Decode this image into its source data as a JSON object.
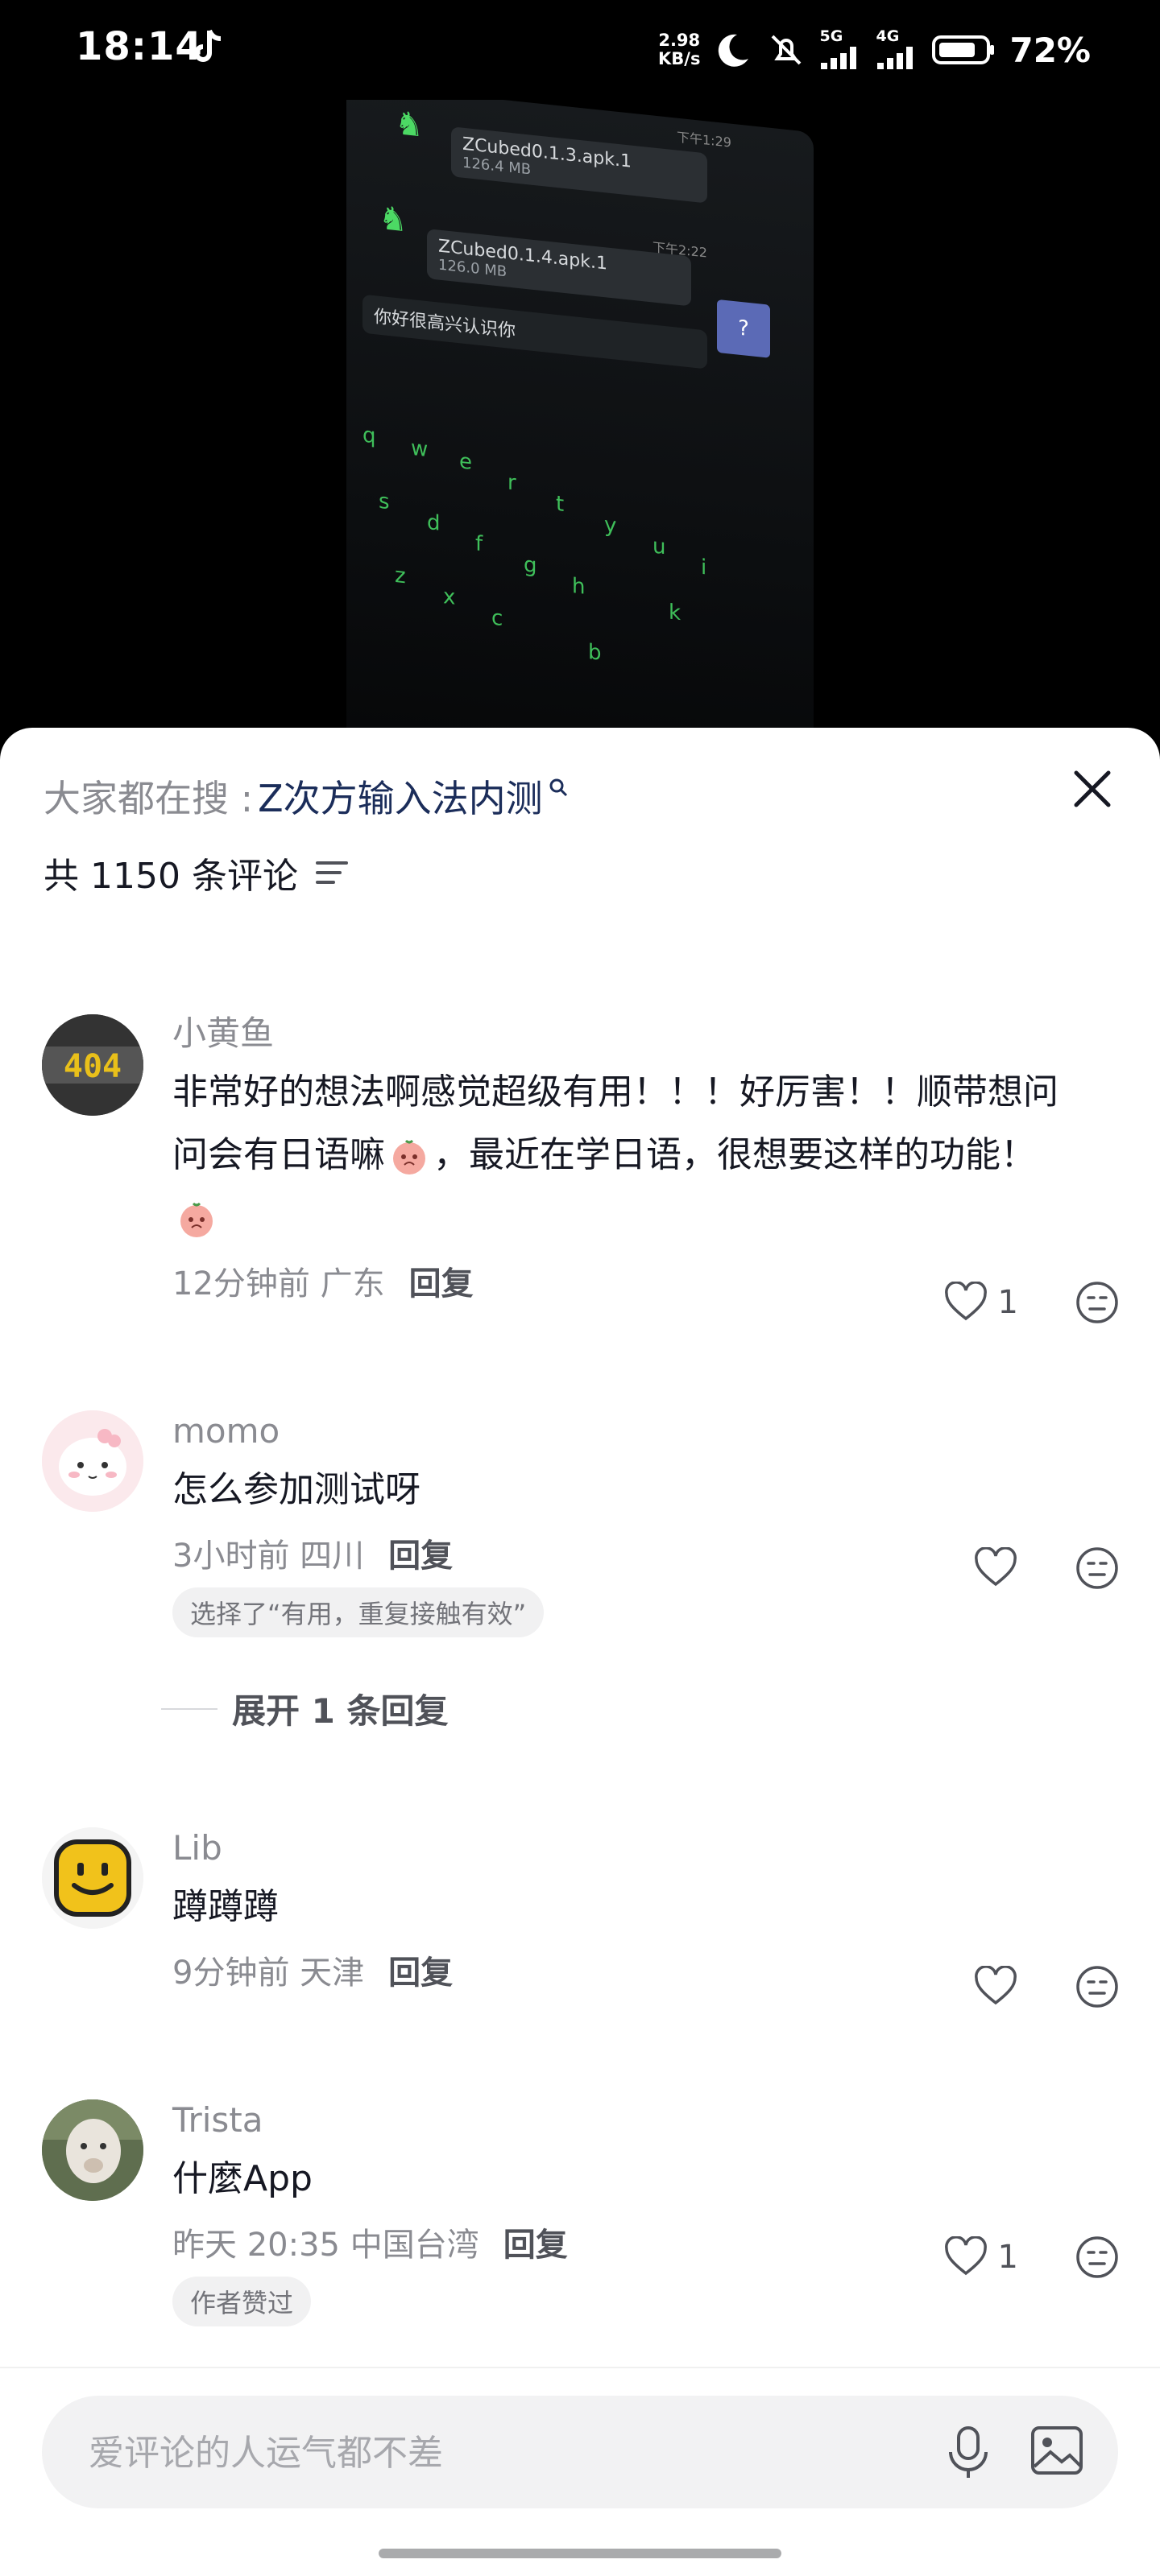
{
  "status_bar": {
    "time": "18:14",
    "net_speed_value": "2.98",
    "net_speed_unit": "KB/s",
    "net_5g": "5G",
    "net_4g": "4G",
    "battery": "72%"
  },
  "video": {
    "file1_name": "ZCubed0.1.3.apk.1",
    "file1_size": "126.4 MB",
    "file1_time": "下午1:29",
    "file2_name": "ZCubed0.1.4.apk.1",
    "file2_size": "126.0 MB",
    "file2_time": "下午2:22",
    "input_text": "你好很高兴认识你"
  },
  "sheet": {
    "hot_search_prefix": "大家都在搜 :",
    "hot_search_term": "Z次方输入法内测",
    "comment_count": "共 1150 条评论"
  },
  "comments": [
    {
      "name": "小黄鱼",
      "text_part1": "非常好的想法啊感觉超级有用！！！好厉害！！顺带想问问会有日语嘛",
      "text_part2": "，最近在学日语，很想要这样的功能！",
      "time_location": "12分钟前 广东",
      "reply": "回复",
      "likes": "1"
    },
    {
      "name": "momo",
      "text": "怎么参加测试呀",
      "time_location": "3小时前 四川",
      "reply": "回复",
      "tag": "选择了“有用，重复接触有效”",
      "expand": "展开 1 条回复"
    },
    {
      "name": "Lib",
      "text": "蹲蹲蹲",
      "time_location": "9分钟前 天津",
      "reply": "回复"
    },
    {
      "name": "Trista",
      "text": "什麼App",
      "time_location": "昨天 20:35 中国台湾",
      "reply": "回复",
      "likes": "1",
      "tag": "作者赞过"
    }
  ],
  "input": {
    "placeholder": "爱评论的人运气都不差"
  },
  "icons": {
    "close": "close-icon",
    "filter": "filter-icon",
    "like": "heart-icon",
    "dislike": "dislike-face-icon",
    "mic": "mic-icon",
    "image": "image-icon"
  }
}
